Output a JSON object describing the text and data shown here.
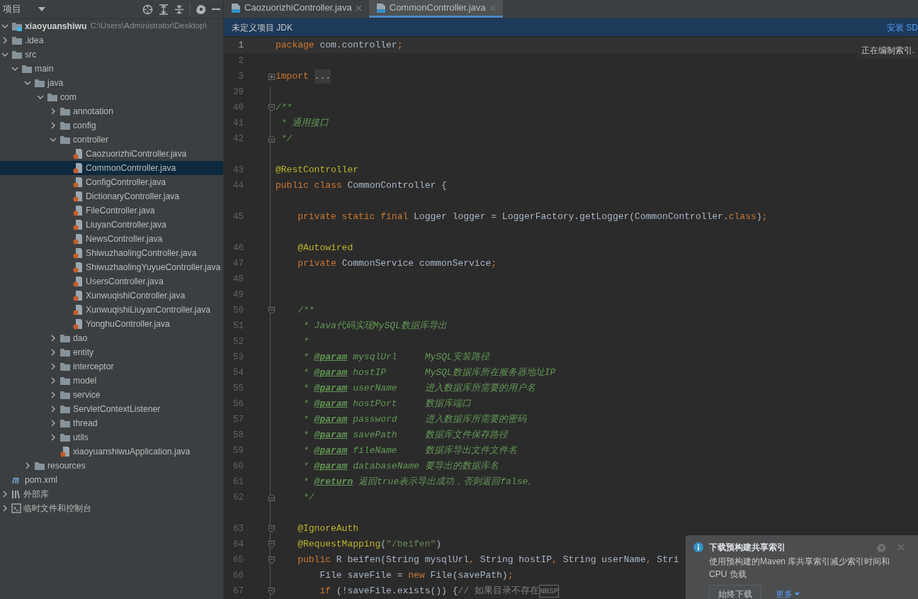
{
  "project_panel": {
    "title": "项目",
    "tree": [
      {
        "label": "xiaoyuanshiwu",
        "kind": "module",
        "hint": "C:\\Users\\Administrator\\Desktop\\",
        "expanded": true,
        "selected": false,
        "children": [
          {
            "label": ".idea",
            "kind": "folder",
            "expanded": false,
            "selected": false
          },
          {
            "label": "src",
            "kind": "folder",
            "expanded": true,
            "selected": false,
            "children": [
              {
                "label": "main",
                "kind": "folder",
                "expanded": true,
                "selected": false,
                "children": [
                  {
                    "label": "java",
                    "kind": "folder",
                    "expanded": true,
                    "selected": false,
                    "children": [
                      {
                        "label": "com",
                        "kind": "folder",
                        "expanded": true,
                        "selected": false,
                        "children": [
                          {
                            "label": "annotation",
                            "kind": "folder",
                            "expanded": false,
                            "selected": false
                          },
                          {
                            "label": "config",
                            "kind": "folder",
                            "expanded": false,
                            "selected": false
                          },
                          {
                            "label": "controller",
                            "kind": "folder",
                            "expanded": true,
                            "selected": false,
                            "children": [
                              {
                                "label": "CaozuorizhiController.java",
                                "kind": "java",
                                "selected": false
                              },
                              {
                                "label": "CommonController.java",
                                "kind": "java",
                                "selected": true
                              },
                              {
                                "label": "ConfigController.java",
                                "kind": "java",
                                "selected": false
                              },
                              {
                                "label": "DictionaryController.java",
                                "kind": "java",
                                "selected": false
                              },
                              {
                                "label": "FileController.java",
                                "kind": "java",
                                "selected": false
                              },
                              {
                                "label": "LiuyanController.java",
                                "kind": "java",
                                "selected": false
                              },
                              {
                                "label": "NewsController.java",
                                "kind": "java",
                                "selected": false
                              },
                              {
                                "label": "ShiwuzhaolingController.java",
                                "kind": "java",
                                "selected": false
                              },
                              {
                                "label": "ShiwuzhaolingYuyueController.java",
                                "kind": "java",
                                "selected": false
                              },
                              {
                                "label": "UsersController.java",
                                "kind": "java",
                                "selected": false
                              },
                              {
                                "label": "XunwuqishiController.java",
                                "kind": "java",
                                "selected": false
                              },
                              {
                                "label": "XunwuqishiLiuyanController.java",
                                "kind": "java",
                                "selected": false
                              },
                              {
                                "label": "YonghuController.java",
                                "kind": "java",
                                "selected": false
                              }
                            ]
                          },
                          {
                            "label": "dao",
                            "kind": "folder",
                            "expanded": false,
                            "selected": false
                          },
                          {
                            "label": "entity",
                            "kind": "folder",
                            "expanded": false,
                            "selected": false
                          },
                          {
                            "label": "interceptor",
                            "kind": "folder",
                            "expanded": false,
                            "selected": false
                          },
                          {
                            "label": "model",
                            "kind": "folder",
                            "expanded": false,
                            "selected": false
                          },
                          {
                            "label": "service",
                            "kind": "folder",
                            "expanded": false,
                            "selected": false
                          },
                          {
                            "label": "ServletContextListener",
                            "kind": "folder",
                            "expanded": false,
                            "selected": false
                          },
                          {
                            "label": "thread",
                            "kind": "folder",
                            "expanded": false,
                            "selected": false
                          },
                          {
                            "label": "utils",
                            "kind": "folder",
                            "expanded": false,
                            "selected": false
                          },
                          {
                            "label": "xiaoyuanshiwuApplication.java",
                            "kind": "java",
                            "selected": false
                          }
                        ]
                      }
                    ]
                  },
                  {
                    "label": "resources",
                    "kind": "folder",
                    "expanded": false,
                    "selected": false
                  }
                ]
              }
            ]
          },
          {
            "label": "pom.xml",
            "kind": "maven",
            "selected": false
          }
        ]
      },
      {
        "label": "外部库",
        "kind": "library",
        "expanded": false,
        "selected": false
      },
      {
        "label": "临时文件和控制台",
        "kind": "scratch",
        "expanded": false,
        "selected": false
      }
    ]
  },
  "tabs": [
    {
      "label": "CaozuorizhiController.java",
      "selected": false
    },
    {
      "label": "CommonController.java",
      "selected": true
    }
  ],
  "banner": {
    "text": "未定义项目 JDK",
    "link": "安装 SD"
  },
  "tooltip": "正在编制索引.",
  "code_lines": [
    {
      "n": "1",
      "current": true,
      "tokens": [
        {
          "kind": "kw",
          "text": "package"
        },
        {
          "kind": "plain",
          "text": " com.controller"
        },
        {
          "kind": "kw",
          "text": ";"
        }
      ]
    },
    {
      "n": "2",
      "current": false
    },
    {
      "n": "3",
      "current": false,
      "folded": true,
      "tokens": [
        {
          "kind": "kw",
          "text": "import "
        },
        {
          "kind": "folded",
          "text": "..."
        }
      ]
    },
    {
      "n": "39",
      "current": false
    },
    {
      "n": "40",
      "current": false,
      "fold_start": true,
      "tokens": [
        {
          "kind": "doc",
          "text": "/**"
        }
      ]
    },
    {
      "n": "41",
      "current": false,
      "tokens": [
        {
          "kind": "doc",
          "text": " * 通用接口"
        }
      ]
    },
    {
      "n": "42",
      "current": false,
      "fold_end": true,
      "tokens": [
        {
          "kind": "doc",
          "text": " */"
        }
      ]
    },
    {
      "kind": "gap"
    },
    {
      "n": "43",
      "current": false,
      "tokens": [
        {
          "kind": "ann",
          "text": "@RestController"
        }
      ]
    },
    {
      "n": "44",
      "current": false,
      "tokens": [
        {
          "kind": "kw",
          "text": "public class "
        },
        {
          "kind": "plain",
          "text": "CommonController {"
        }
      ]
    },
    {
      "kind": "gap"
    },
    {
      "n": "45",
      "current": false,
      "tokens": [
        {
          "kind": "kw",
          "text": "    private static final "
        },
        {
          "kind": "plain",
          "text": "Logger logger = LoggerFactory.getLogger(CommonController."
        },
        {
          "kind": "kw",
          "text": "class"
        },
        {
          "kind": "plain",
          "text": ")"
        },
        {
          "kind": "kw",
          "text": ";"
        }
      ]
    },
    {
      "kind": "gap"
    },
    {
      "n": "46",
      "current": false,
      "tokens": [
        {
          "kind": "ann",
          "text": "    @Autowired"
        }
      ]
    },
    {
      "n": "47",
      "current": false,
      "tokens": [
        {
          "kind": "kw",
          "text": "    private "
        },
        {
          "kind": "plain",
          "text": "CommonService commonService"
        },
        {
          "kind": "kw",
          "text": ";"
        }
      ]
    },
    {
      "n": "48",
      "current": false
    },
    {
      "n": "49",
      "current": false
    },
    {
      "n": "50",
      "current": false,
      "fold_start": true,
      "tokens": [
        {
          "kind": "doc",
          "text": "    /**"
        }
      ]
    },
    {
      "n": "51",
      "current": false,
      "tokens": [
        {
          "kind": "doc",
          "text": "     * Java代码实现MySQL数据库导出"
        }
      ]
    },
    {
      "n": "52",
      "current": false,
      "tokens": [
        {
          "kind": "doc",
          "text": "     *"
        }
      ]
    },
    {
      "n": "53",
      "current": false,
      "tokens": [
        {
          "kind": "doc",
          "text": "     * "
        },
        {
          "kind": "doctag",
          "text": "@param"
        },
        {
          "kind": "doc",
          "text": " mysqlUrl     MySQL安装路径"
        }
      ]
    },
    {
      "n": "54",
      "current": false,
      "tokens": [
        {
          "kind": "doc",
          "text": "     * "
        },
        {
          "kind": "doctag",
          "text": "@param"
        },
        {
          "kind": "doc",
          "text": " hostIP       MySQL数据库所在服务器地址IP"
        }
      ]
    },
    {
      "n": "55",
      "current": false,
      "tokens": [
        {
          "kind": "doc",
          "text": "     * "
        },
        {
          "kind": "doctag",
          "text": "@param"
        },
        {
          "kind": "doc",
          "text": " userName     进入数据库所需要的用户名"
        }
      ]
    },
    {
      "n": "56",
      "current": false,
      "tokens": [
        {
          "kind": "doc",
          "text": "     * "
        },
        {
          "kind": "doctag",
          "text": "@param"
        },
        {
          "kind": "doc",
          "text": " hostPort     数据库端口"
        }
      ]
    },
    {
      "n": "57",
      "current": false,
      "tokens": [
        {
          "kind": "doc",
          "text": "     * "
        },
        {
          "kind": "doctag",
          "text": "@param"
        },
        {
          "kind": "doc",
          "text": " password     进入数据库所需要的密码"
        }
      ]
    },
    {
      "n": "58",
      "current": false,
      "tokens": [
        {
          "kind": "doc",
          "text": "     * "
        },
        {
          "kind": "doctag",
          "text": "@param"
        },
        {
          "kind": "doc",
          "text": " savePath     数据库文件保存路径"
        }
      ]
    },
    {
      "n": "59",
      "current": false,
      "tokens": [
        {
          "kind": "doc",
          "text": "     * "
        },
        {
          "kind": "doctag",
          "text": "@param"
        },
        {
          "kind": "doc",
          "text": " fileName     数据库导出文件文件名"
        }
      ]
    },
    {
      "n": "60",
      "current": false,
      "tokens": [
        {
          "kind": "doc",
          "text": "     * "
        },
        {
          "kind": "doctag",
          "text": "@param"
        },
        {
          "kind": "doc",
          "text": " databaseName 要导出的数据库名"
        }
      ]
    },
    {
      "n": "61",
      "current": false,
      "tokens": [
        {
          "kind": "doc",
          "text": "     * "
        },
        {
          "kind": "doctag",
          "text": "@return"
        },
        {
          "kind": "doc",
          "text": " 返回true表示导出成功，否则返回false。"
        }
      ]
    },
    {
      "n": "62",
      "current": false,
      "fold_end": true,
      "tokens": [
        {
          "kind": "doc",
          "text": "     */"
        }
      ]
    },
    {
      "kind": "gap"
    },
    {
      "n": "63",
      "current": false,
      "fold_start": true,
      "tokens": [
        {
          "kind": "ann",
          "text": "    @IgnoreAuth"
        }
      ]
    },
    {
      "n": "64",
      "current": false,
      "fold_start": true,
      "tokens": [
        {
          "kind": "ann",
          "text": "    @RequestMapping"
        },
        {
          "kind": "plain",
          "text": "("
        },
        {
          "kind": "str",
          "text": "\"/beifen\""
        },
        {
          "kind": "plain",
          "text": ")"
        }
      ]
    },
    {
      "n": "65",
      "current": false,
      "fold_start": true,
      "tokens": [
        {
          "kind": "kw",
          "text": "    public "
        },
        {
          "kind": "plain",
          "text": "R beifen(String mysqlUrl"
        },
        {
          "kind": "kw",
          "text": ", "
        },
        {
          "kind": "plain",
          "text": "String hostIP"
        },
        {
          "kind": "kw",
          "text": ", "
        },
        {
          "kind": "plain",
          "text": "String userName"
        },
        {
          "kind": "kw",
          "text": ", "
        },
        {
          "kind": "plain",
          "text": "Stri"
        }
      ]
    },
    {
      "n": "66",
      "current": false,
      "tokens": [
        {
          "kind": "plain",
          "text": "        File saveFile = "
        },
        {
          "kind": "kw",
          "text": "new "
        },
        {
          "kind": "plain",
          "text": "File(savePath)"
        },
        {
          "kind": "kw",
          "text": ";"
        }
      ]
    },
    {
      "n": "67",
      "current": false,
      "fold_start": true,
      "tokens": [
        {
          "kind": "kw",
          "text": "        if "
        },
        {
          "kind": "plain",
          "text": "(!saveFile.exists()) {"
        },
        {
          "kind": "comment",
          "text": "// 如果目录不存在"
        },
        {
          "kind": "nbsp",
          "text": "NBSP"
        }
      ]
    }
  ],
  "notification": {
    "title": "下载预构建共享索引",
    "body": "使用预构建的Maven 库共享索引减少索引时间和 CPU 负载",
    "button": "始终下载",
    "link": "更多"
  }
}
